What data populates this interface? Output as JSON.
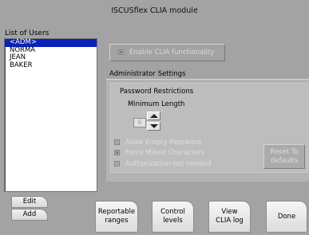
{
  "window": {
    "title": "ISCUSflex CLIA module"
  },
  "users": {
    "label": "List of Users",
    "items": [
      {
        "name": "<ADM>",
        "selected": true
      },
      {
        "name": "NORMA",
        "selected": false
      },
      {
        "name": "JEAN",
        "selected": false
      },
      {
        "name": "BAKER",
        "selected": false
      }
    ]
  },
  "clia": {
    "enable_label": "Enable CLIA functionality",
    "checked": true,
    "enabled": false
  },
  "admin": {
    "section_label": "Administrator Settings",
    "password_title": "Password Restrictions",
    "min_length_label": "Minimum Length",
    "min_length_value": "6",
    "options": [
      {
        "label": "Allow Empty Password",
        "checked": false
      },
      {
        "label": "Force Mixed Characters",
        "checked": true
      },
      {
        "label": "Authorization not needed",
        "checked": false
      }
    ],
    "reset_line1": "Reset To",
    "reset_line2": "defaults"
  },
  "buttons": {
    "edit": "Edit",
    "add": "Add",
    "reportable_line1": "Reportable",
    "reportable_line2": "ranges",
    "control_line1": "Control",
    "control_line2": "levels",
    "view_line1": "View",
    "view_line2": "CLIA log",
    "done": "Done"
  },
  "icons": {
    "spin_up": "arrow-up-icon",
    "spin_down": "arrow-down-icon"
  },
  "colors": {
    "background": "#a3a3a3",
    "selection": "#0a22b8",
    "disabled_text": "#d8d8d8"
  }
}
